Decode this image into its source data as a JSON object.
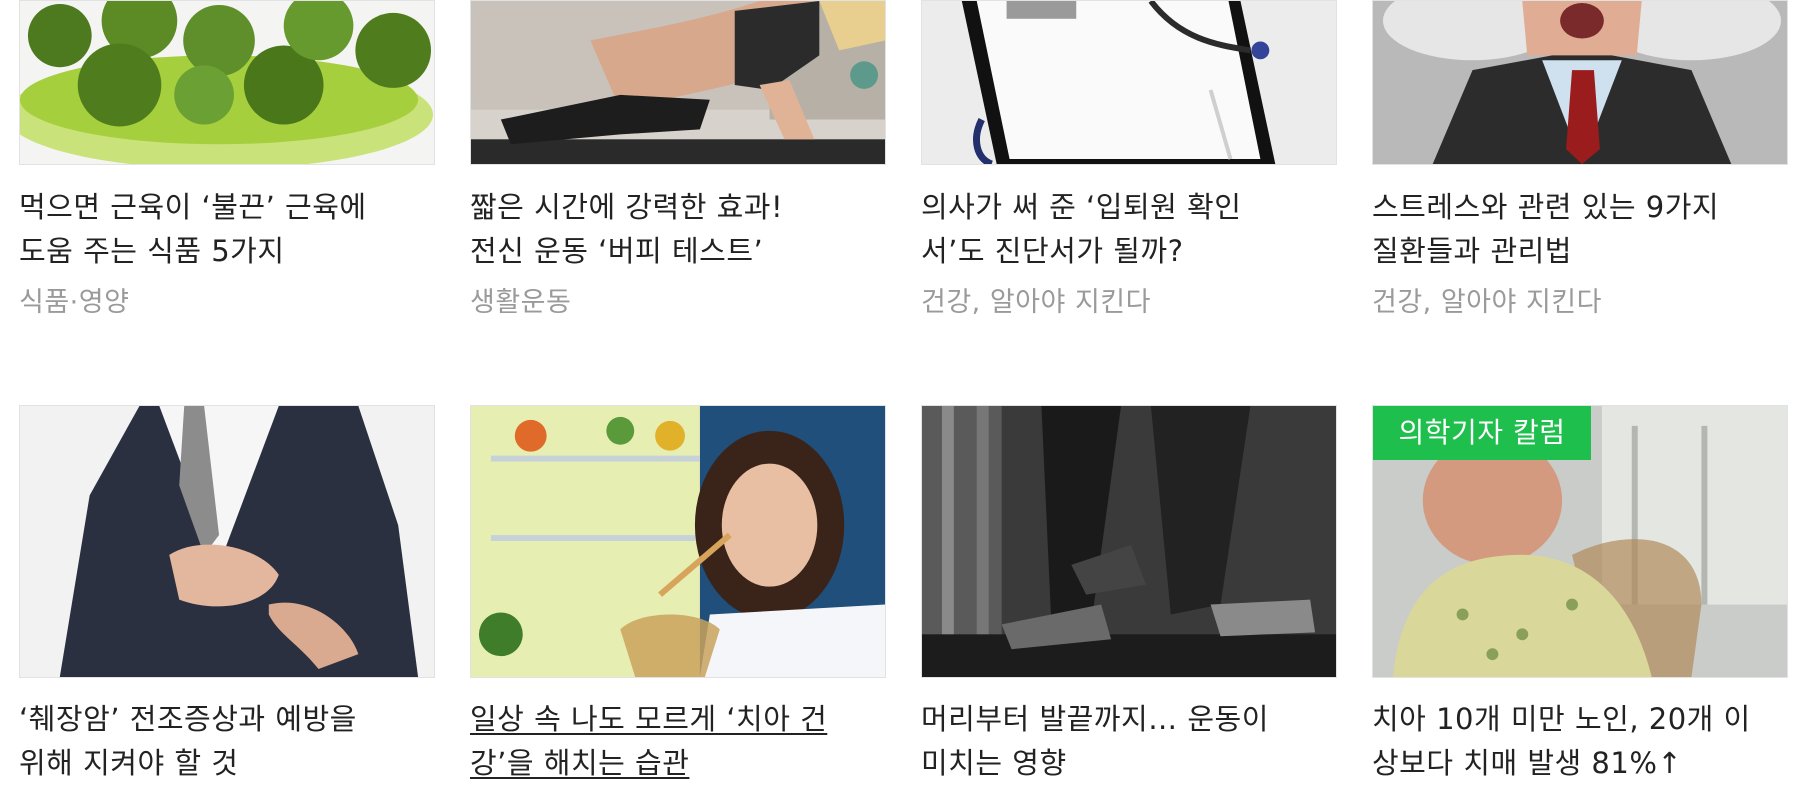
{
  "articles_row1": [
    {
      "title_line1": "먹으면 근육이 ‘불끈’ 근육에",
      "title_line2": "도움 주는 식품 5가지",
      "category": "식품·영양",
      "image": "broccoli-bowl-photo"
    },
    {
      "title_line1": "짧은 시간에 강력한 효과!",
      "title_line2": "전신 운동 ‘버피 테스트’",
      "category": "생활운동",
      "image": "woman-pushup-photo"
    },
    {
      "title_line1": "의사가 써 준 ‘입퇴원 확인",
      "title_line2": "서’도 진단서가 될까?",
      "category": "건강, 알아야 지킨다",
      "image": "clipboard-stethoscope-photo"
    },
    {
      "title_line1": "스트레스와 관련 있는 9가지",
      "title_line2": "질환들과 관리법",
      "category": "건강, 알아야 지킨다",
      "image": "stressed-man-photo"
    }
  ],
  "articles_row2": [
    {
      "title_line1": "‘췌장암’ 전조증상과 예방을",
      "title_line2": "위해 지켜야 할 것",
      "image": "man-holding-stomach-photo"
    },
    {
      "title_line1": "일상 속 나도 모르게 ‘치아 건",
      "title_line2": "강’을 해치는 습관",
      "image": "woman-eating-at-fridge-photo"
    },
    {
      "title_line1": "머리부터 발끝까지… 운동이",
      "title_line2": "미치는 영향",
      "image": "treadmill-running-photo"
    },
    {
      "title_line1": "치아 10개 미만 노인, 20개 이",
      "title_line2": "상보다 치매 발생 81%↑",
      "image": "elderly-man-window-photo",
      "badge": "의학기자 칼럼"
    }
  ],
  "colors": {
    "badge": "#1fbf4d",
    "category_text": "#9a9a9a",
    "title_text": "#222222"
  }
}
